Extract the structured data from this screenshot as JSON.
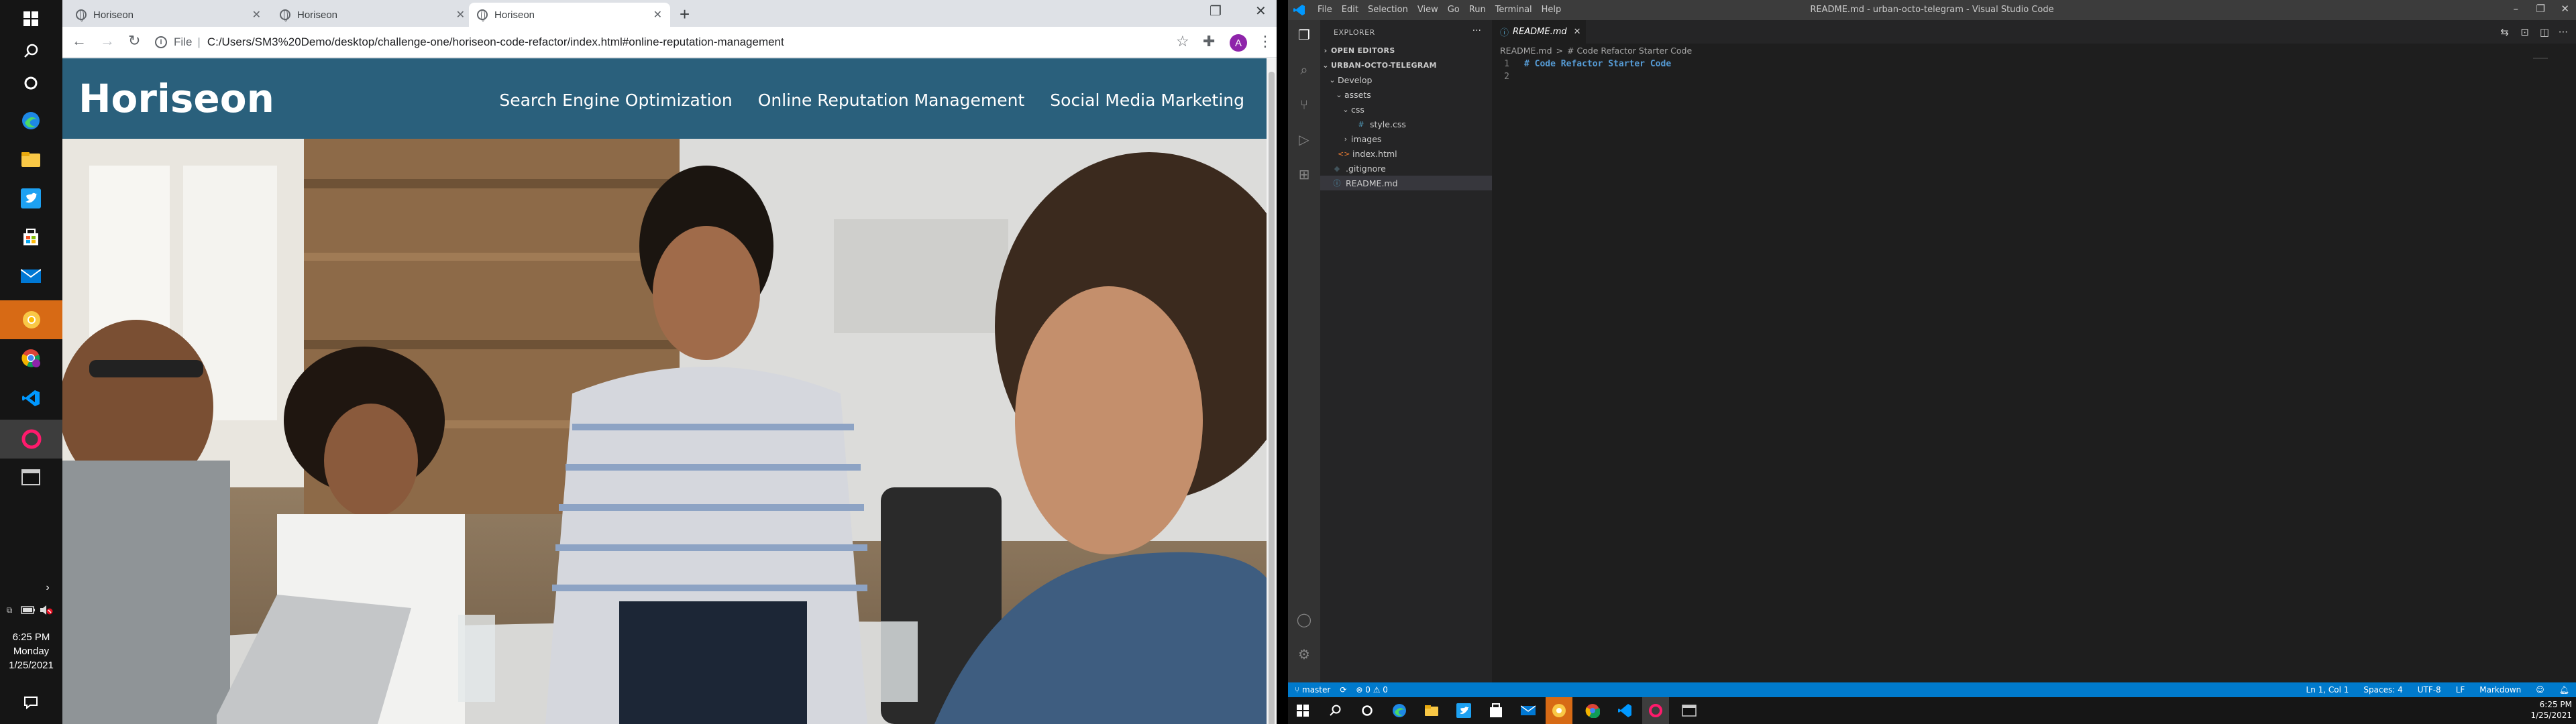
{
  "left_taskbar": {
    "clock": {
      "time": "6:25 PM",
      "day": "Monday",
      "date": "1/25/2021"
    }
  },
  "chrome": {
    "tabs": [
      {
        "title": "Horiseon",
        "active": false
      },
      {
        "title": "Horiseon",
        "active": false
      },
      {
        "title": "Horiseon",
        "active": true
      }
    ],
    "new_tab": "+",
    "omnibox": {
      "scheme_label": "File",
      "url": "C:/Users/SM3%20Demo/desktop/challenge-one/horiseon-code-refactor/index.html#online-reputation-management"
    },
    "profile_initial": "A"
  },
  "site": {
    "logo": "Horiseon",
    "nav": [
      "Search Engine Optimization",
      "Online Reputation Management",
      "Social Media Marketing"
    ]
  },
  "vscode": {
    "menu": [
      "File",
      "Edit",
      "Selection",
      "View",
      "Go",
      "Run",
      "Terminal",
      "Help"
    ],
    "window_title": "README.md - urban-octo-telegram - Visual Studio Code",
    "explorer_title": "EXPLORER",
    "open_editors": "OPEN EDITORS",
    "workspace": "URBAN-OCTO-TELEGRAM",
    "tree": [
      {
        "label": "Develop",
        "kind": "folder",
        "depth": 1,
        "open": true
      },
      {
        "label": "assets",
        "kind": "folder",
        "depth": 2,
        "open": true
      },
      {
        "label": "css",
        "kind": "folder",
        "depth": 3,
        "open": true
      },
      {
        "label": "style.css",
        "kind": "css",
        "depth": 4
      },
      {
        "label": "images",
        "kind": "folder",
        "depth": 3,
        "open": false
      },
      {
        "label": "index.html",
        "kind": "html",
        "depth": 2
      },
      {
        "label": ".gitignore",
        "kind": "git",
        "depth": 1
      },
      {
        "label": "README.md",
        "kind": "md",
        "depth": 1,
        "selected": true
      }
    ],
    "editor_tab": "README.md",
    "breadcrumb": [
      "README.md",
      ">",
      "# Code Refactor Starter Code"
    ],
    "code_lines": [
      {
        "n": "1",
        "text": "# Code Refactor Starter Code"
      },
      {
        "n": "2",
        "text": ""
      }
    ],
    "status": {
      "branch": "master",
      "problems": "⊗ 0 ⚠ 0",
      "cursor": "Ln 1, Col 1",
      "spaces": "Spaces: 4",
      "encoding": "UTF-8",
      "eol": "LF",
      "language": "Markdown"
    }
  },
  "bottom_taskbar": {
    "clock": {
      "time": "6:25 PM",
      "date": "1/25/2021"
    }
  },
  "colors": {
    "site_header": "#2a607c",
    "vscode_status": "#007acc",
    "chrome_tabstrip": "#dee1e6"
  }
}
